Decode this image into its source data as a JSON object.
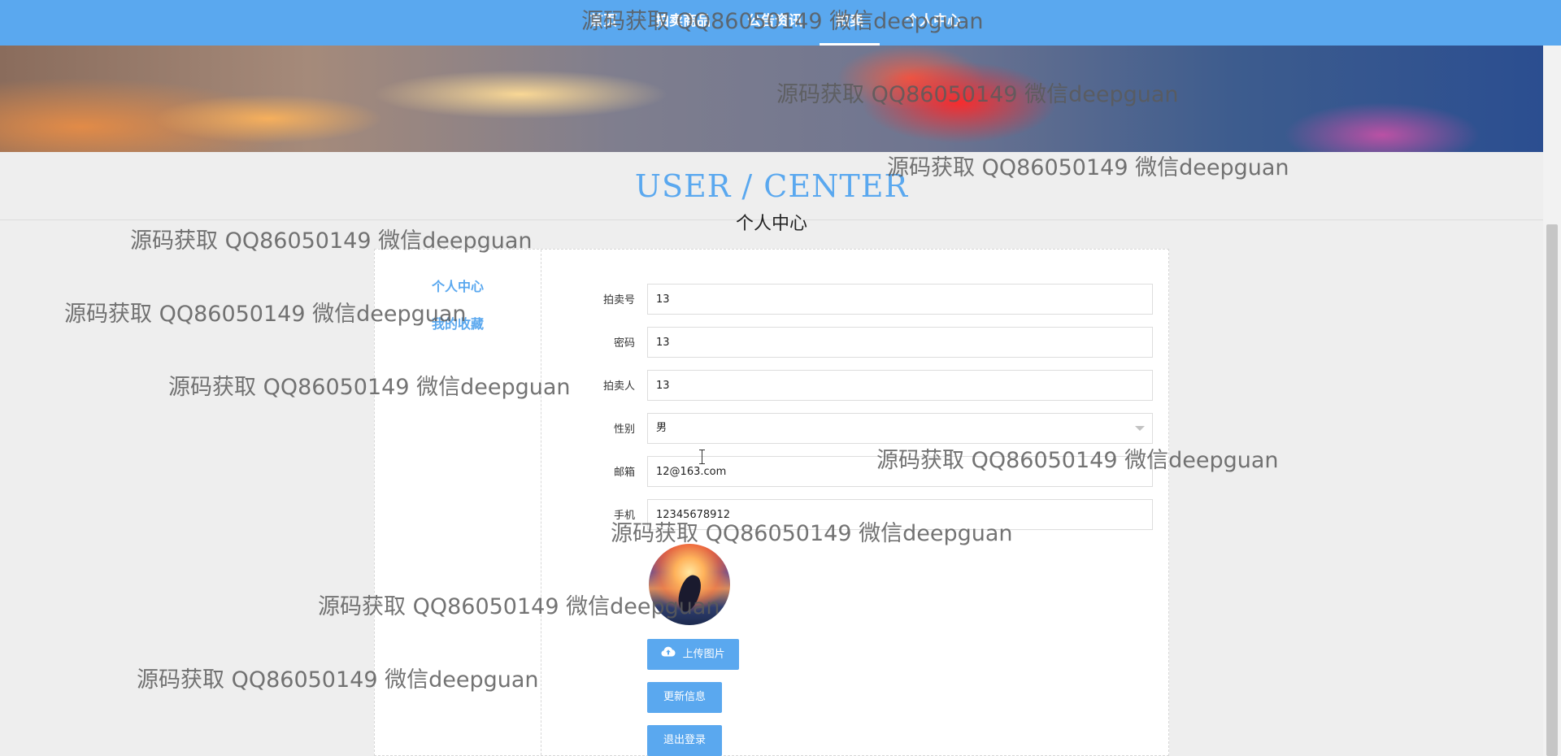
{
  "nav": {
    "items": [
      {
        "label": "首页"
      },
      {
        "label": "拍卖商品"
      },
      {
        "label": "公告资讯"
      },
      {
        "label": "拍卖"
      },
      {
        "label": "个人中心"
      }
    ]
  },
  "header": {
    "title_en": "USER / CENTER",
    "title_zh": "个人中心"
  },
  "sidebar": {
    "items": [
      {
        "label": "个人中心"
      },
      {
        "label": "我的收藏"
      }
    ]
  },
  "form": {
    "fields": [
      {
        "label": "拍卖号",
        "value": "13"
      },
      {
        "label": "密码",
        "value": "13"
      },
      {
        "label": "拍卖人",
        "value": "13"
      },
      {
        "label": "性别",
        "value": "男"
      },
      {
        "label": "邮箱",
        "value": "12@163.com"
      },
      {
        "label": "手机",
        "value": "12345678912"
      }
    ],
    "upload_label": "上传图片",
    "update_label": "更新信息",
    "logout_label": "退出登录"
  },
  "watermark": {
    "text": "源码获取 QQ86050149 微信deepguan"
  },
  "colors": {
    "accent": "#5aa8ef",
    "page_bg": "#eeeeee"
  },
  "icons": {
    "upload": "cloud-upload-icon",
    "select": "chevron-down-icon"
  }
}
